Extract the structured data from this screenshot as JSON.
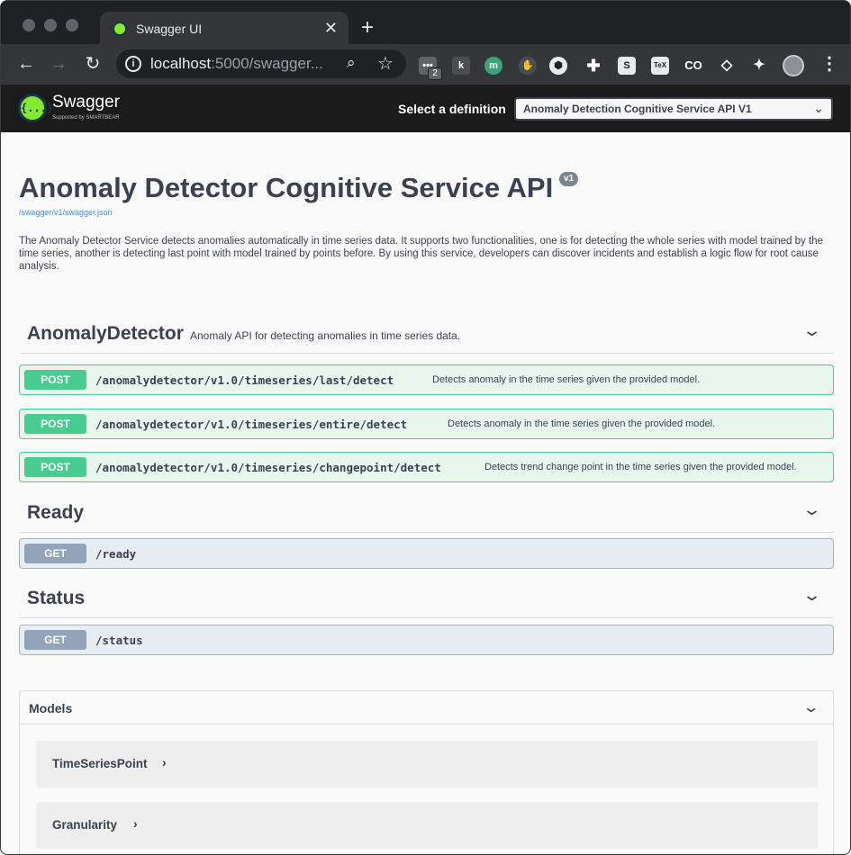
{
  "browser": {
    "tab_title": "Swagger UI",
    "tab_close": "✕",
    "new_tab": "+",
    "url_host": "localhost",
    "url_rest": ":5000/swagger...",
    "extension_badge": "2",
    "icons": [
      "back-icon",
      "forward-icon",
      "reload-icon",
      "info-icon",
      "zoom-icon",
      "star-icon",
      "extensions-icon",
      "menu-icon"
    ]
  },
  "topbar": {
    "logo_text": "Swagger",
    "logo_sub": "Supported by SMARTBEAR",
    "logo_mark": "{...}",
    "select_label": "Select a definition",
    "selected_definition": "Anomaly Detection Cognitive Service API V1"
  },
  "info": {
    "title": "Anomaly Detector Cognitive Service API",
    "version": "v1",
    "spec_url": "/swagger/v1/swagger.json",
    "description": "The Anomaly Detector Service detects anomalies automatically in time series data. It supports two functionalities, one is for detecting the whole series with model trained by the time series, another is detecting last point with model trained by points before. By using this service, developers can discover incidents and establish a logic flow for root cause analysis."
  },
  "tags": [
    {
      "name": "AnomalyDetector",
      "description": "Anomaly API for detecting anomalies in time series data.",
      "operations": [
        {
          "method": "POST",
          "path": "/anomalydetector/v1.0/timeseries/last/detect",
          "summary": "Detects anomaly in the time series given the provided model."
        },
        {
          "method": "POST",
          "path": "/anomalydetector/v1.0/timeseries/entire/detect",
          "summary": "Detects anomaly in the time series given the provided model."
        },
        {
          "method": "POST",
          "path": "/anomalydetector/v1.0/timeseries/changepoint/detect",
          "summary": "Detects trend change point in the time series given the provided model."
        }
      ]
    },
    {
      "name": "Ready",
      "description": "",
      "operations": [
        {
          "method": "GET",
          "path": "/ready",
          "summary": ""
        }
      ]
    },
    {
      "name": "Status",
      "description": "",
      "operations": [
        {
          "method": "GET",
          "path": "/status",
          "summary": ""
        }
      ]
    }
  ],
  "models": {
    "title": "Models",
    "items": [
      "TimeSeriesPoint",
      "Granularity"
    ]
  },
  "colors": {
    "post": "#49cc90",
    "get": "#91a4b9",
    "text": "#3b4151",
    "brand": "#85ea2d"
  }
}
